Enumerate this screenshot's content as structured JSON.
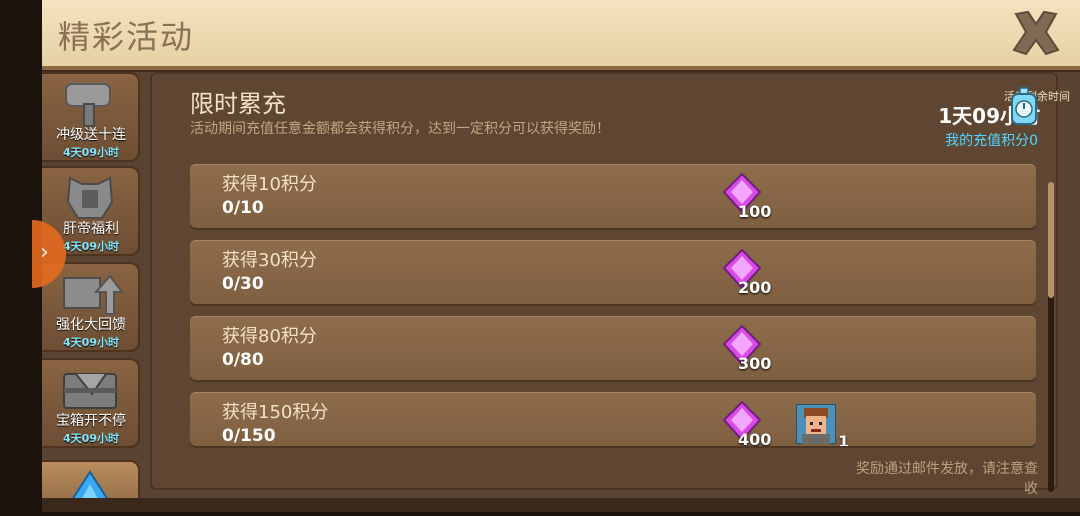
{
  "header": {
    "title": "精彩活动"
  },
  "sidebar": {
    "items": [
      {
        "label": "冲级送十连",
        "timer": "4天09小时",
        "icon": "hammer-icon"
      },
      {
        "label": "肝帝福利",
        "timer": "4天09小时",
        "icon": "armor-icon"
      },
      {
        "label": "强化大回馈",
        "timer": "4天09小时",
        "icon": "anvil-upgrade-icon"
      },
      {
        "label": "宝箱开不停",
        "timer": "4天09小时",
        "icon": "chest-icon"
      },
      {
        "label": "",
        "timer": "",
        "icon": "diamond-pile-icon"
      }
    ]
  },
  "panel": {
    "title": "限时累充",
    "description": "活动期间充值任意金额都会获得积分，达到一定积分可以获得奖励！",
    "remaining_label": "活动剩余时间",
    "remaining_value": "1天09小时",
    "points_label": "我的充值积分",
    "points_value": "0"
  },
  "tasks": [
    {
      "name": "获得10积分",
      "progress": "0/10",
      "gem_count": "100"
    },
    {
      "name": "获得30积分",
      "progress": "0/30",
      "gem_count": "200"
    },
    {
      "name": "获得80积分",
      "progress": "0/80",
      "gem_count": "300"
    },
    {
      "name": "获得150积分",
      "progress": "0/150",
      "gem_count": "400",
      "hero_count": "1"
    }
  ],
  "footer": {
    "note": "奖励通过邮件发放，请注意查收"
  },
  "colors": {
    "accent_cyan": "#52d6ff",
    "gem_magenta": "#d94be6",
    "header_bg": "#f3e3bf"
  }
}
